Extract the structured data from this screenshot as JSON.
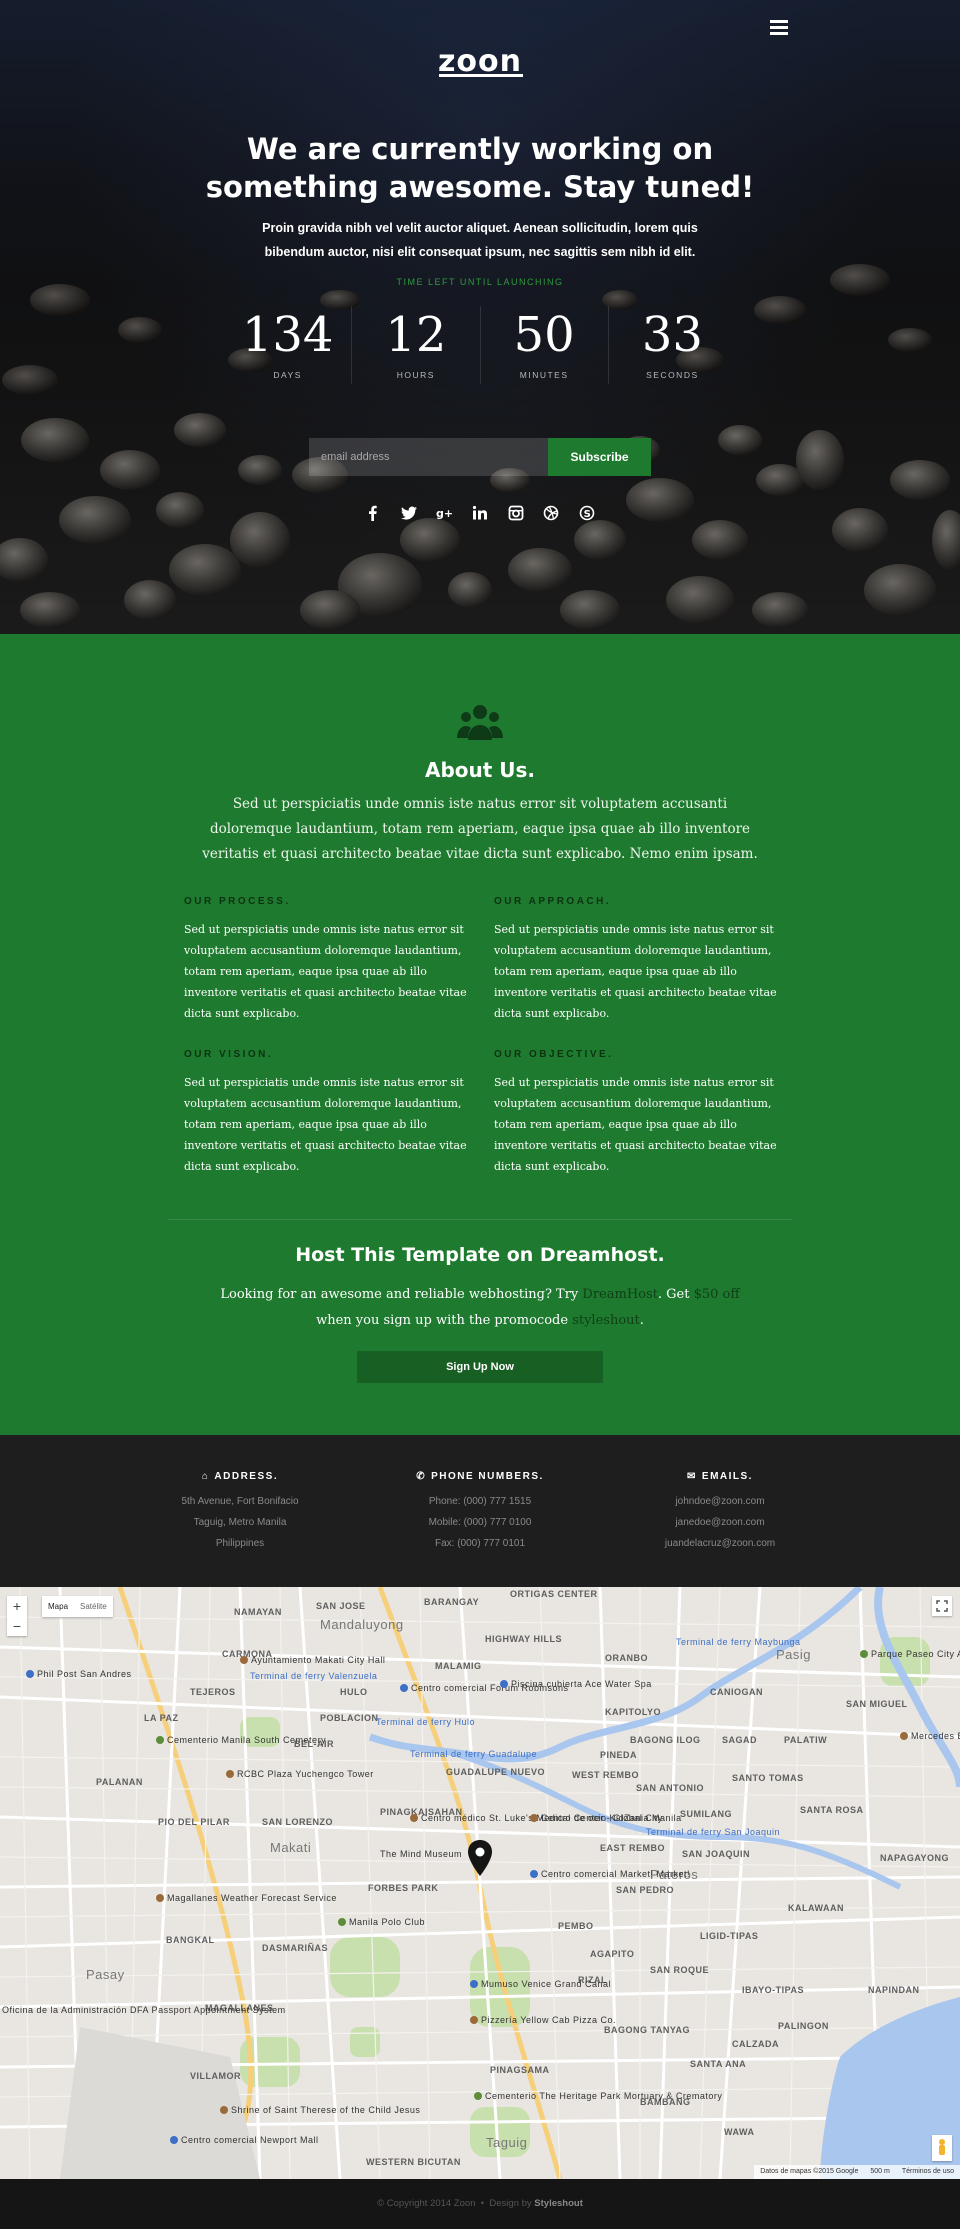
{
  "hero": {
    "logo": "zoon",
    "headline_line1": "We are currently working on",
    "headline_line2": "something awesome. Stay tuned!",
    "lead": "Proin gravida nibh vel velit auctor aliquet. Aenean sollicitudin, lorem quis bibendum auctor, nisi elit consequat ipsum, nec sagittis sem nibh id elit.",
    "time_label": "TIME LEFT UNTIL LAUNCHING",
    "countdown": [
      {
        "value": "134",
        "label": "DAYS"
      },
      {
        "value": "12",
        "label": "HOURS"
      },
      {
        "value": "50",
        "label": "MINUTES"
      },
      {
        "value": "33",
        "label": "SECONDS"
      }
    ],
    "email_placeholder": "email address",
    "subscribe_label": "Subscribe",
    "social_icons": [
      "facebook-icon",
      "twitter-icon",
      "google-plus-icon",
      "linkedin-icon",
      "instagram-icon",
      "dribbble-icon",
      "skype-icon"
    ],
    "accent": "#1e7a2e"
  },
  "about": {
    "title": "About Us.",
    "lead": "Sed ut perspiciatis unde omnis iste natus error sit voluptatem accusanti doloremque laudantium, totam rem aperiam, eaque ipsa quae ab illo inventore veritatis et quasi architecto beatae vitae dicta sunt explicabo. Nemo enim ipsam.",
    "blocks": [
      {
        "title": "OUR PROCESS.",
        "text": "Sed ut perspiciatis unde omnis iste natus error sit voluptatem accusantium doloremque laudantium, totam rem aperiam, eaque ipsa quae ab illo inventore veritatis et quasi architecto beatae vitae dicta sunt explicabo."
      },
      {
        "title": "OUR APPROACH.",
        "text": "Sed ut perspiciatis unde omnis iste natus error sit voluptatem accusantium doloremque laudantium, totam rem aperiam, eaque ipsa quae ab illo inventore veritatis et quasi architecto beatae vitae dicta sunt explicabo."
      },
      {
        "title": "OUR VISION.",
        "text": "Sed ut perspiciatis unde omnis iste natus error sit voluptatem accusantium doloremque laudantium, totam rem aperiam, eaque ipsa quae ab illo inventore veritatis et quasi architecto beatae vitae dicta sunt explicabo."
      },
      {
        "title": "OUR OBJECTIVE.",
        "text": "Sed ut perspiciatis unde omnis iste natus error sit voluptatem accusantium doloremque laudantium, totam rem aperiam, eaque ipsa quae ab illo inventore veritatis et quasi architecto beatae vitae dicta sunt explicabo."
      }
    ],
    "background": "#1e7a2e"
  },
  "host": {
    "title": "Host This Template on Dreamhost.",
    "text_1": "Looking for an awesome and reliable webhosting? Try ",
    "link_dreamhost": "DreamHost",
    "text_2": ". Get ",
    "link_offer": "$50 off",
    "text_3": " when you sign up with the promocode ",
    "promocode": "styleshout",
    "text_4": ".",
    "button": "Sign Up Now"
  },
  "contact": {
    "address": {
      "title": "ADDRESS.",
      "lines": [
        "5th Avenue, Fort Bonifacio",
        "Taguig, Metro Manila",
        "Philippines"
      ]
    },
    "phones": {
      "title": "PHONE NUMBERS.",
      "lines": [
        "Phone: (000) 777 1515",
        "Mobile: (000) 777 0100",
        "Fax: (000) 777 0101"
      ]
    },
    "emails": {
      "title": "EMAILS.",
      "lines": [
        "johndoe@zoon.com",
        "janedoe@zoon.com",
        "juandelacruz@zoon.com"
      ]
    }
  },
  "map": {
    "type_map": "Mapa",
    "type_satellite": "Satélite",
    "zoom_in": "+",
    "zoom_out": "−",
    "attribution": "Datos de mapas ©2015 Google",
    "scale": "500 m",
    "terms": "Términos de uso",
    "labels": {
      "mandaluyong": "Mandaluyong",
      "makati": "Makati",
      "pasay": "Pasay",
      "taguig": "Taguig",
      "pasig": "Pasig",
      "ortigas": "ORTIGAS CENTER",
      "barangay": "BARANGAY",
      "highway_hills": "HIGHWAY HILLS",
      "malamig": "MALAMIG",
      "oranbo": "ORANBO",
      "kapitolyo": "KAPITOLYO",
      "canlogan": "CANIOGAN",
      "pineda": "PINEDA",
      "guadalupe": "GUADALUPE NUEVO",
      "west_rembo": "WEST REMBO",
      "pinagkaisahan": "PINAGKAISAHAN",
      "east_rembo": "EAST REMBO",
      "san_joaquin": "SAN JOAQUIN",
      "pio_del_pilar": "PIO DEL PILAR",
      "san_lorenzo": "SAN LORENZO",
      "forbes_park": "FORBES PARK",
      "dasmarinas": "DASMARIÑAS",
      "magallanes": "MAGALLANES",
      "villamor": "VILLAMOR",
      "pinagsama": "PINAGSAMA",
      "western_bicutan": "WESTERN BICUTAN",
      "sta_ana": "SANTA ANA",
      "bambang": "BAMBANG",
      "wawa": "WAWA",
      "calzada": "CALZADA",
      "palingon": "PALINGON",
      "napindan": "NAPINDAN",
      "ibayo_tipas": "IBAYO-TIPAS",
      "ligid_tipas": "LIGID-TIPAS",
      "kalawaan": "KALAWAAN",
      "rizal": "RIZAL",
      "pembo": "PEMBO",
      "bangkal": "BANGKAL",
      "palanan": "PALANAN",
      "poblacion": "POBLACION",
      "bel_air": "BEL-AIR",
      "hulo": "HULO",
      "tejeros": "TEJEROS",
      "carmona": "CARMONA",
      "la_paz": "LA PAZ",
      "namayan": "NAMAYAN",
      "san_jose": "SAN JOSE",
      "sagad": "SAGAD",
      "palatiw": "PALATIW",
      "santo_tomas": "SANTO TOMAS",
      "sumilang": "SUMILANG",
      "san_miguel": "SAN MIGUEL",
      "napagayong": "NAPAGAYONG",
      "sta_rosa": "SANTA ROSA",
      "bagong_ilog": "BAGONG ILOG",
      "san_antonio": "SAN ANTONIO",
      "san_pedro": "SAN PEDRO",
      "pateros": "Pateros",
      "san_roque": "SAN ROQUE",
      "bagong_tanyag": "BAGONG TANYAG",
      "agapito": "AGAPITO",
      "poi_market": "Centro comercial Market! Market!",
      "poi_forum": "Centro comercial Forum Robinsons",
      "poi_piscina": "Piscina cubierta Ace Water Spa",
      "poi_ayuntamiento": "Ayuntamiento Makati City Hall",
      "poi_cementerio": "Cementerio Manila South Cemetery",
      "poi_rcbc": "RCBC Plaza Yuchengco Tower",
      "poi_centro_medico": "Centro médico St. Luke's Medical Center - Global City",
      "poi_centro_ocio": "Centro de ocio KidZania Manila",
      "poi_mind_museum": "The Mind Museum",
      "poi_polo": "Manila Polo Club",
      "poi_magallanes": "Magallanes Weather Forecast Service",
      "poi_mumuso": "Mumuso Venice Grand Canal",
      "poi_pizzeria": "Pizzería Yellow Cab Pizza Co.",
      "poi_heritage": "Cementerio The Heritage Park Mortuary & Crematory",
      "poi_shrine": "Shrine of Saint Therese of the Child Jesus",
      "poi_newport": "Centro comercial Newport Mall",
      "poi_parque": "Parque Paseo City Adventure Experience",
      "poi_mercedes": "Mercedes Executive Vil",
      "poi_oficina": "Oficina de la Administración DFA Passport Appointment System",
      "poi_phil_post": "Phil Post San Andres",
      "poi_ferry": "Terminal de ferry Valenzuela",
      "poi_ferry2": "Terminal de ferry Hulo",
      "poi_ferry3": "Terminal de ferry Guadalupe",
      "poi_ferry4": "Terminal de ferry San Joaquin",
      "poi_ferry5": "Terminal de ferry Maybunga"
    }
  },
  "footer": {
    "copyright": "© Copyright 2014 Zoon",
    "separator": "•",
    "design_by": "Design by",
    "designer": "Styleshout"
  }
}
